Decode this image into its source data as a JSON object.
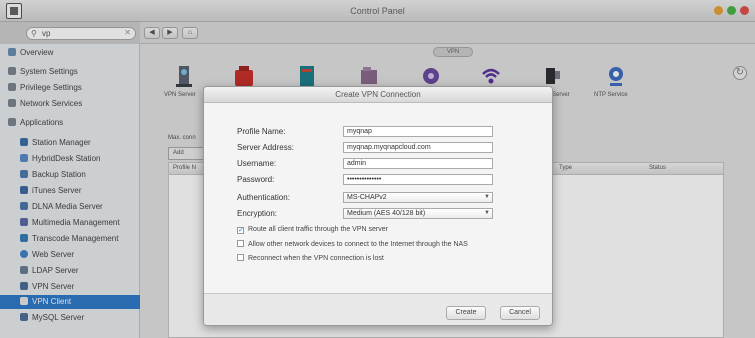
{
  "window": {
    "title": "Control Panel"
  },
  "search": {
    "value": "vp"
  },
  "sidebar": {
    "items": [
      {
        "label": "Overview"
      },
      {
        "label": "System Settings"
      },
      {
        "label": "Privilege Settings"
      },
      {
        "label": "Network Services"
      },
      {
        "label": "Applications"
      },
      {
        "label": "Station Manager"
      },
      {
        "label": "HybridDesk Station"
      },
      {
        "label": "Backup Station"
      },
      {
        "label": "iTunes Server"
      },
      {
        "label": "DLNA Media Server"
      },
      {
        "label": "Multimedia Management"
      },
      {
        "label": "Transcode Management"
      },
      {
        "label": "Web Server"
      },
      {
        "label": "LDAP Server"
      },
      {
        "label": "VPN Server"
      },
      {
        "label": "VPN Client"
      },
      {
        "label": "MySQL Server"
      }
    ]
  },
  "main": {
    "tab_label": "VPN",
    "services": [
      {
        "label": "VPN Server"
      },
      {
        "label": ""
      },
      {
        "label": ""
      },
      {
        "label": ""
      },
      {
        "label": ""
      },
      {
        "label": ""
      },
      {
        "label": "Server"
      },
      {
        "label": "NTP Service"
      }
    ],
    "max_count": "Max. conn",
    "add_button": "Add",
    "columns": {
      "c1": "Profile N",
      "c2": "Type",
      "c3": "Status"
    }
  },
  "dialog": {
    "title": "Create VPN Connection",
    "profile_name_label": "Profile Name:",
    "profile_name": "myqnap",
    "server_address_label": "Server Address:",
    "server_address": "myqnap.myqnapcloud.com",
    "username_label": "Username:",
    "username": "admin",
    "password_label": "Password:",
    "password": "••••••••••••••",
    "authentication_label": "Authentication:",
    "authentication": "MS-CHAPv2",
    "encryption_label": "Encryption:",
    "encryption": "Medium (AES 40/128 bit)",
    "option1": "Route all client traffic through the VPN server",
    "option2": "Allow other network devices to connect to the Internet through the NAS",
    "option3": "Reconnect when the VPN connection is lost",
    "create_label": "Create",
    "cancel_label": "Cancel"
  }
}
